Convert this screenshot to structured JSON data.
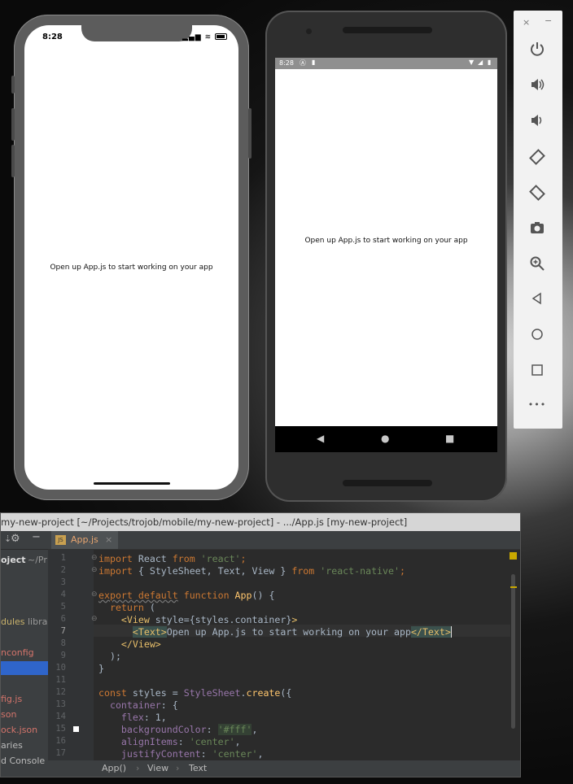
{
  "ios_simulator": {
    "time": "8:28",
    "app_text": "Open up App.js to start working on your app"
  },
  "android_emulator": {
    "time": "8:28",
    "app_text": "Open up App.js to start working on your app",
    "nav": {
      "back": "◀",
      "home": "●",
      "recents": "■"
    }
  },
  "emulator_toolbar": {
    "close": "×",
    "minimize": "−",
    "icons": [
      "power-icon",
      "volume-up-icon",
      "volume-down-icon",
      "rotate-left-icon",
      "rotate-right-icon",
      "camera-icon",
      "zoom-icon",
      "back-icon",
      "home-icon",
      "overview-icon",
      "more-icon"
    ],
    "more_label": "•••"
  },
  "ide": {
    "title": "my-new-project [~/Projects/trojob/mobile/my-new-project] - .../App.js [my-new-project]",
    "tab_label": "App.js",
    "sidebar_items": [
      "oject",
      "~/Pr",
      "dules",
      "libra",
      "nconfig",
      "fig.js",
      "son",
      "ock.json",
      "aries",
      "d Console"
    ],
    "line_numbers": [
      "1",
      "2",
      "3",
      "4",
      "5",
      "6",
      "7",
      "8",
      "9",
      "10",
      "11",
      "12",
      "13",
      "14",
      "15",
      "16",
      "17"
    ],
    "breadcrumb": [
      "App()",
      "View",
      "Text"
    ],
    "code": {
      "l1": [
        "import",
        "React",
        "from",
        "'react'",
        ";"
      ],
      "l2": [
        "import",
        "{ StyleSheet, Text, View }",
        "from",
        "'react-native'",
        ";"
      ],
      "l4": [
        "export default",
        "function",
        "App",
        "() {"
      ],
      "l5": [
        "return",
        "("
      ],
      "l6": [
        "<View",
        " style={styles.container}",
        ">"
      ],
      "l7": [
        "<Text>",
        "Open up App.js to start working on your app",
        "</Text>"
      ],
      "l8": [
        "</View>"
      ],
      "l9": [
        ");"
      ],
      "l10": [
        "}"
      ],
      "l12": [
        "const",
        " styles = ",
        "StyleSheet",
        ".",
        "create",
        "({"
      ],
      "l13": [
        "container",
        ": {"
      ],
      "l14": [
        "flex",
        ": 1,"
      ],
      "l15": [
        "backgroundColor",
        ": ",
        "'#fff'",
        ","
      ],
      "l16": [
        "alignItems",
        ": ",
        "'center'",
        ","
      ],
      "l17": [
        "justifyContent",
        ": ",
        "'center'",
        ","
      ]
    }
  }
}
